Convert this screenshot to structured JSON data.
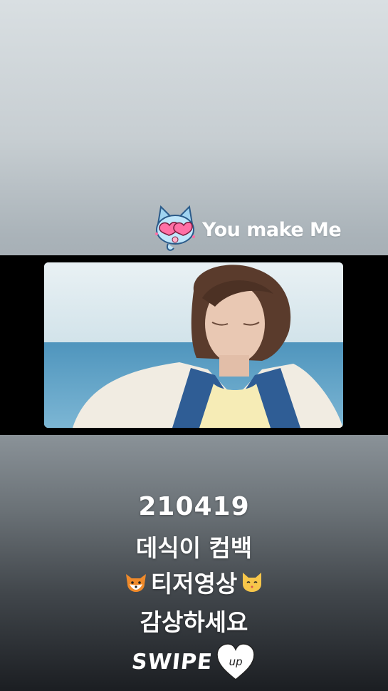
{
  "sticker": {
    "icon": "cat-with-heart-sunglasses-icon",
    "text": "You make Me"
  },
  "video": {
    "icon": "video-preview-person-by-sea",
    "colors": {
      "sky": "#e3ecf0",
      "sea": "#5a9ec2",
      "shirt": "#f4ebd2",
      "jacket": "#2f5d95"
    }
  },
  "caption": {
    "date": "210419",
    "line1": "데식이 컴백",
    "line2_text": "티저영상",
    "line2_left_emoji": "fox-face-icon",
    "line2_right_emoji": "cat-face-icon",
    "line3": "감상하세요"
  },
  "swipe": {
    "label": "SWIPE",
    "heart_label": "up"
  },
  "colors": {
    "text": "#ffffff",
    "band": "#000000"
  }
}
